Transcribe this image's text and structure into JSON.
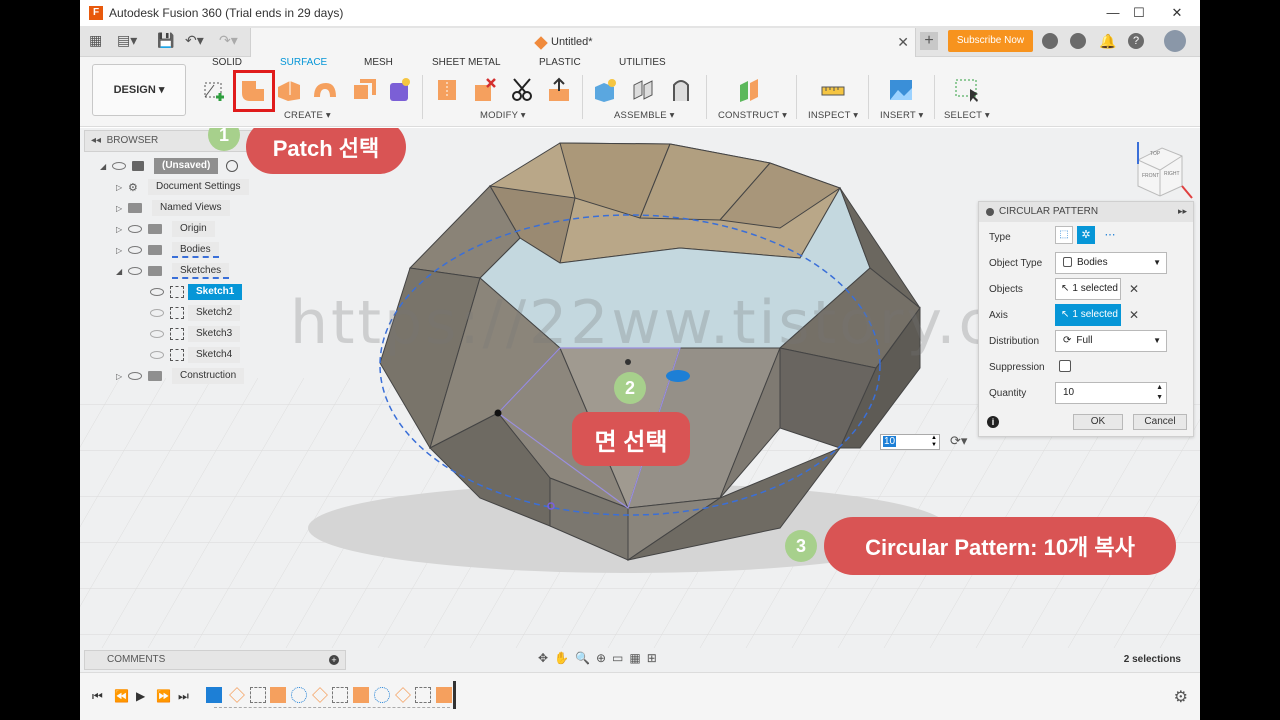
{
  "app": {
    "title": "Autodesk Fusion 360 (Trial ends in 29 days)",
    "document_tab": "Untitled*",
    "subscribe_label": "Subscribe Now"
  },
  "workspace": {
    "design_label": "DESIGN ▾",
    "ribbon_tabs": [
      "SOLID",
      "SURFACE",
      "MESH",
      "SHEET METAL",
      "PLASTIC",
      "UTILITIES"
    ],
    "active_tab": "SURFACE",
    "groups": [
      "CREATE ▾",
      "MODIFY ▾",
      "ASSEMBLE ▾",
      "CONSTRUCT ▾",
      "INSPECT ▾",
      "INSERT ▾",
      "SELECT ▾"
    ]
  },
  "browser": {
    "header": "BROWSER",
    "items": [
      {
        "label": "(Unsaved)",
        "level": 0
      },
      {
        "label": "Document Settings",
        "level": 1
      },
      {
        "label": "Named Views",
        "level": 1
      },
      {
        "label": "Origin",
        "level": 1
      },
      {
        "label": "Bodies",
        "level": 1
      },
      {
        "label": "Sketches",
        "level": 1
      },
      {
        "label": "Sketch1",
        "level": 2,
        "selected": true
      },
      {
        "label": "Sketch2",
        "level": 2
      },
      {
        "label": "Sketch3",
        "level": 2
      },
      {
        "label": "Sketch4",
        "level": 2
      },
      {
        "label": "Construction",
        "level": 1
      }
    ]
  },
  "circular_pattern": {
    "title": "CIRCULAR PATTERN",
    "type_label": "Type",
    "object_type_label": "Object Type",
    "object_type_value": "Bodies",
    "objects_label": "Objects",
    "objects_value": "1 selected",
    "axis_label": "Axis",
    "axis_value": "1 selected",
    "distribution_label": "Distribution",
    "distribution_value": "Full",
    "suppression_label": "Suppression",
    "quantity_label": "Quantity",
    "quantity_value": "10",
    "ok_label": "OK",
    "cancel_label": "Cancel"
  },
  "viewport": {
    "inline_quantity": "10",
    "watermark": "https://22ww.tistory.com",
    "viewcube_labels": [
      "TOP",
      "FRONT",
      "RIGHT"
    ]
  },
  "annotations": [
    {
      "number": "1",
      "text": "Patch 선택"
    },
    {
      "number": "2",
      "text": "면 선택"
    },
    {
      "number": "3",
      "text": "Circular Pattern: 10개 복사"
    }
  ],
  "comments_label": "COMMENTS",
  "status": {
    "selections": "2 selections"
  },
  "colors": {
    "accent": "#0696d7",
    "annotation": "#d95454",
    "badge": "#a7d08c",
    "subscribe": "#f7931e"
  }
}
